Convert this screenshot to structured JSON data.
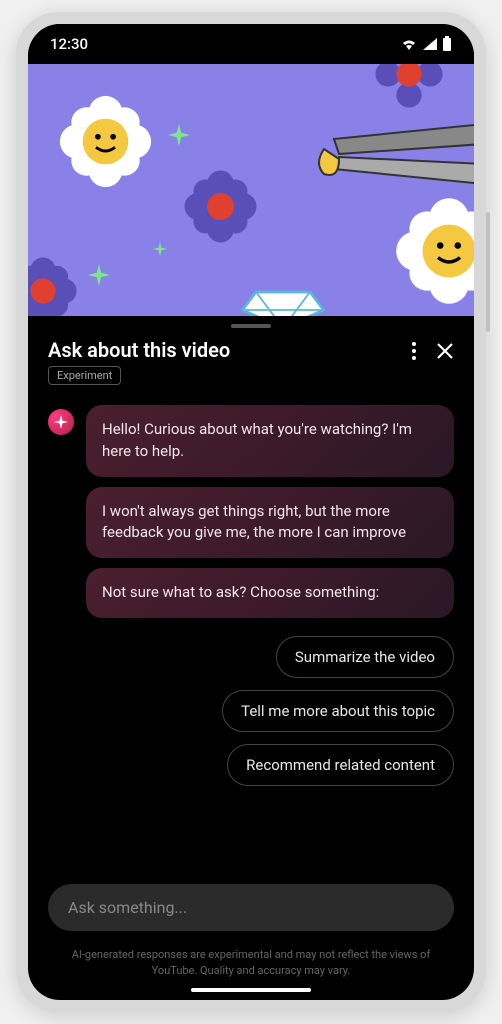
{
  "status": {
    "time": "12:30"
  },
  "header": {
    "title": "Ask about this video",
    "badge": "Experiment"
  },
  "chat": {
    "messages": [
      "Hello! Curious about what you're watching? I'm here to help.",
      "I won't always get things right, but the more feedback you give me, the more I can improve",
      "Not sure what to ask? Choose something:"
    ],
    "suggestions": [
      "Summarize the video",
      "Tell me more about this topic",
      "Recommend related content"
    ]
  },
  "input": {
    "placeholder": "Ask something..."
  },
  "disclaimer": "AI-generated responses are experimental and may not reflect the views of YouTube. Quality and accuracy may vary."
}
